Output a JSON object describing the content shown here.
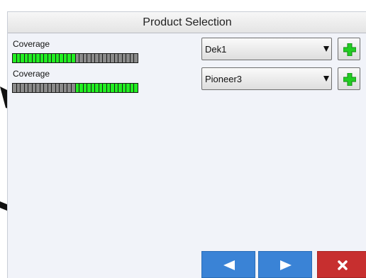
{
  "title": "Product Selection",
  "rows": [
    {
      "coverage_label": "Coverage",
      "coverage_segments": [
        1,
        1,
        1,
        1,
        1,
        1,
        1,
        1,
        1,
        1,
        1,
        1,
        1,
        1,
        1,
        1,
        0,
        0,
        0,
        0,
        0,
        0,
        0,
        0,
        0,
        0,
        0,
        0,
        0,
        0,
        0,
        0
      ],
      "product": "Dek1"
    },
    {
      "coverage_label": "Coverage",
      "coverage_segments": [
        0,
        0,
        0,
        0,
        0,
        0,
        0,
        0,
        0,
        0,
        0,
        0,
        0,
        0,
        0,
        0,
        1,
        1,
        1,
        1,
        1,
        1,
        1,
        1,
        1,
        1,
        1,
        1,
        1,
        1,
        1,
        1
      ],
      "product": "Pioneer3"
    }
  ],
  "colors": {
    "segment_on": "#22ee22",
    "segment_off": "#8a8a8a",
    "nav_button": "#3a83d6",
    "close_button": "#c72f2f",
    "add_icon": "#22cc22"
  },
  "icons": {
    "add": "plus-icon",
    "prev": "triangle-left-icon",
    "next": "triangle-right-icon",
    "close": "x-icon"
  }
}
